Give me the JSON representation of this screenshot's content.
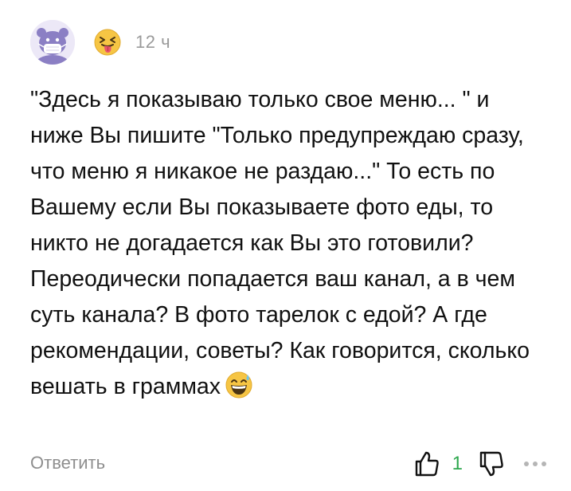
{
  "comment": {
    "time": "12 ч",
    "text": "\"Здесь я показываю только свое меню... \" и ниже Вы пишите \"Только предупреждаю сразу, что меню я никакое не раздаю...\" То есть по Вашему если Вы показываете фото еды, то никто не догадается как Вы это готовили? Переодически попадается ваш канал, а в чем суть канала? В фото тарелок с едой? А где рекомендации, советы? Как говорится, сколько вешать в граммах",
    "reaction_icon": "tongue-squint-emoji",
    "trailing_icon": "grinning-sweat-emoji"
  },
  "footer": {
    "reply_label": "Ответить",
    "like_count": "1"
  },
  "colors": {
    "time": "#9a9a9a",
    "reply": "#8e8e8e",
    "like_count": "#2fa84f",
    "avatar_bg": "#ece8f7",
    "avatar_figure": "#8b7fc4"
  }
}
